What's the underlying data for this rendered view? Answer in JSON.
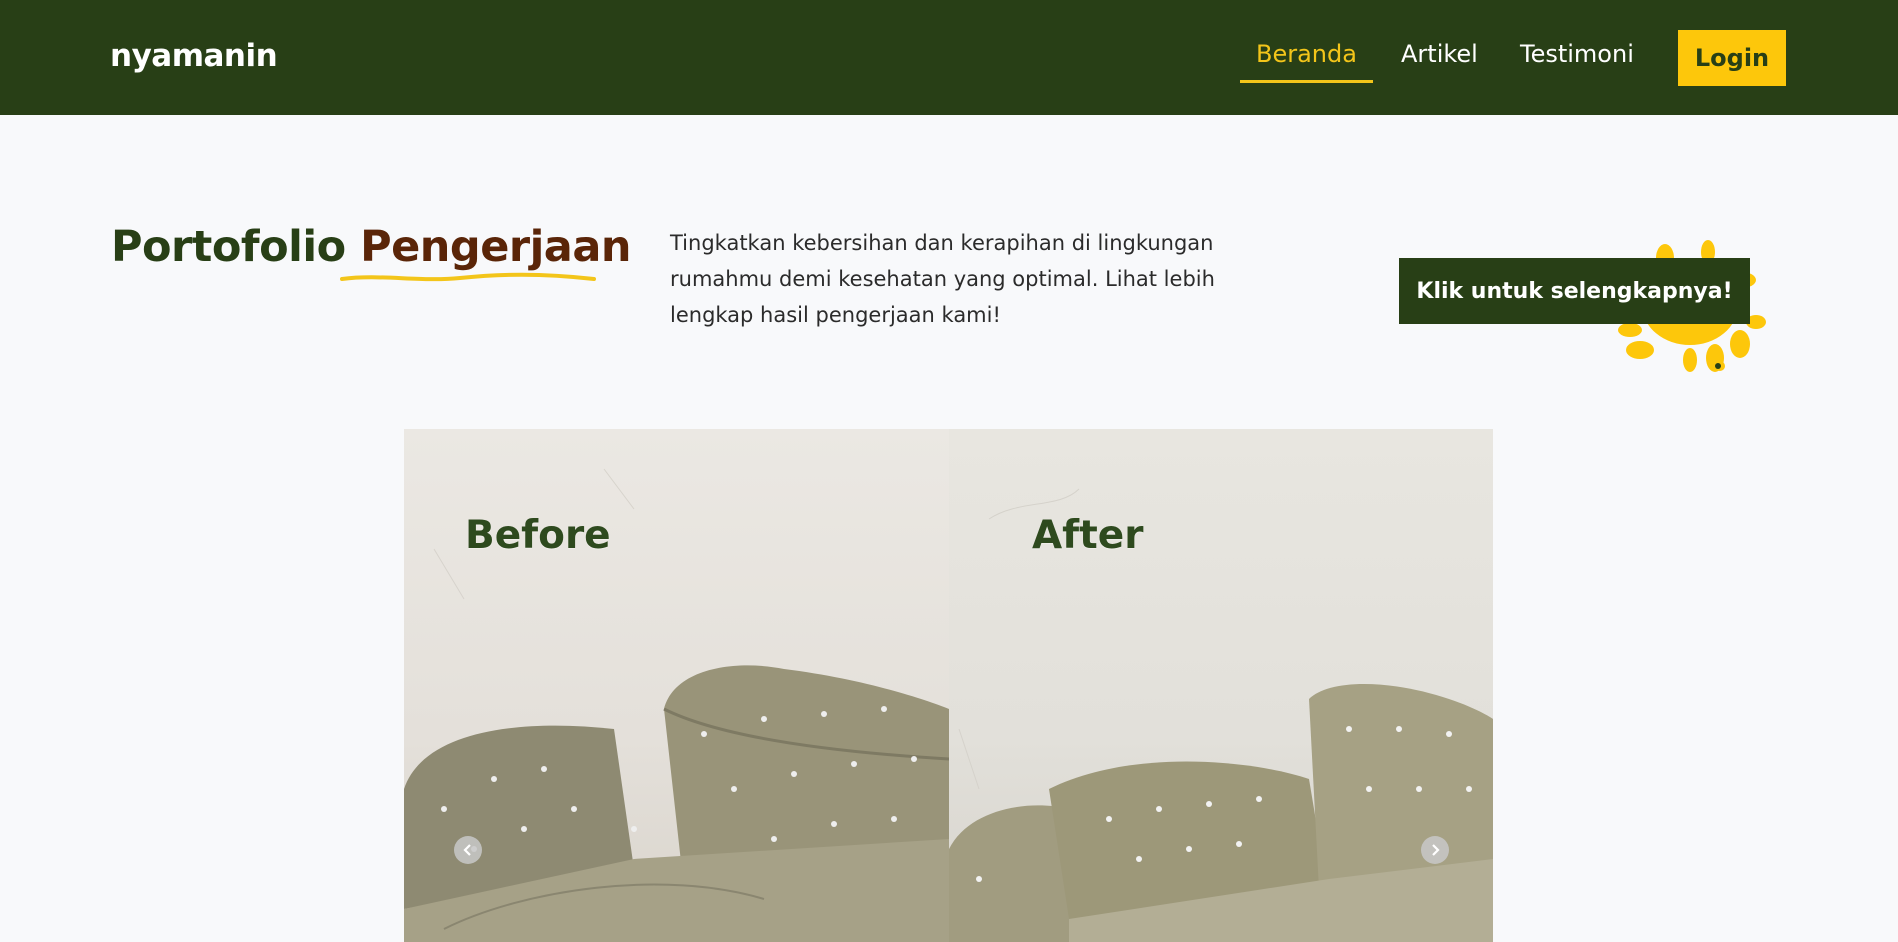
{
  "navbar": {
    "brand": "nyamanin",
    "links": [
      {
        "label": "Beranda",
        "active": true
      },
      {
        "label": "Artikel",
        "active": false
      },
      {
        "label": "Testimoni",
        "active": false
      }
    ],
    "login_label": "Login"
  },
  "hero": {
    "title_part1": "Portofolio",
    "title_part2": "Pengerjaan",
    "description": "Tingkatkan kebersihan dan kerapihan di lingkungan rumahmu demi kesehatan yang optimal. Lihat lebih lengkap hasil pengerjaan kami!",
    "cta_label": "Klik untuk selengkapnya!"
  },
  "carousel": {
    "before_label": "Before",
    "after_label": "After"
  },
  "colors": {
    "primary_green": "#283f16",
    "accent_yellow": "#fdc70b",
    "brown": "#5a2508",
    "background": "#f8f9fb"
  },
  "icons": {
    "prev": "chevron-left-icon",
    "next": "chevron-right-icon",
    "decoration": "paint-splash-icon"
  }
}
